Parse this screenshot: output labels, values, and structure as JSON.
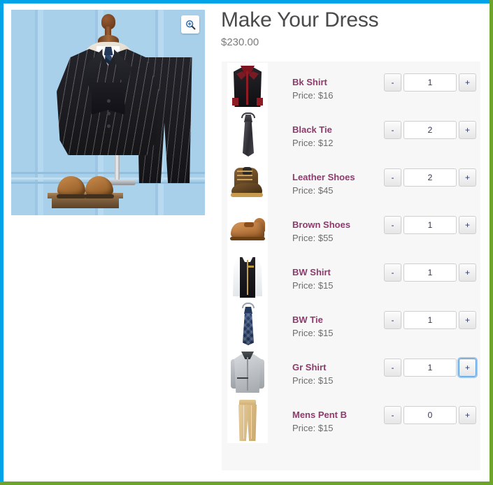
{
  "frame": {
    "border_top_color": "#00a2e8",
    "border_left_color": "#00a2e8",
    "border_right_color": "#6fa42b",
    "border_bottom_color": "#6fa42b"
  },
  "hero": {
    "alt": "black pinstripe three-piece suit on mannequin",
    "zoom_icon": "magnifier-plus-icon"
  },
  "product": {
    "title": "Make Your Dress",
    "price": "$230.00"
  },
  "accent": {
    "name_color": "#8e3a6c",
    "price_color": "#6d6d6d",
    "focus_color": "#5b9dd9"
  },
  "stepper": {
    "decrement_label": "-",
    "increment_label": "+"
  },
  "items": [
    {
      "name": "Bk Shirt",
      "price": "Price: $16",
      "qty": "1",
      "art": "bk-shirt",
      "focused": false
    },
    {
      "name": "Black Tie",
      "price": "Price: $12",
      "qty": "2",
      "art": "black-tie",
      "focused": false
    },
    {
      "name": "Leather Shoes",
      "price": "Price: $45",
      "qty": "2",
      "art": "leather-boot",
      "focused": false
    },
    {
      "name": "Brown Shoes",
      "price": "Price: $55",
      "qty": "1",
      "art": "brown-shoe",
      "focused": false
    },
    {
      "name": "BW Shirt",
      "price": "Price: $15",
      "qty": "1",
      "art": "bw-shirt",
      "focused": false
    },
    {
      "name": "BW Tie",
      "price": "Price: $15",
      "qty": "1",
      "art": "bw-tie",
      "focused": false
    },
    {
      "name": "Gr Shirt",
      "price": "Price: $15",
      "qty": "1",
      "art": "gr-shirt",
      "focused": true
    },
    {
      "name": "Mens Pent B",
      "price": "Price: $15",
      "qty": "0",
      "art": "khaki-pants",
      "focused": false
    }
  ]
}
